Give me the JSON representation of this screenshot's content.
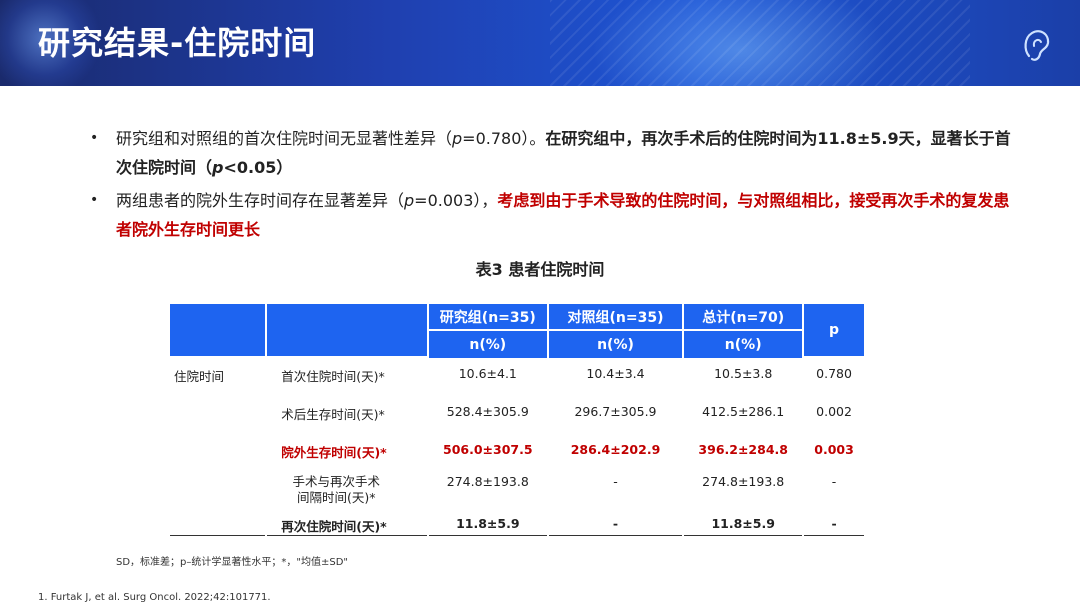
{
  "header": {
    "title": "研究结果-住院时间"
  },
  "bullets": [
    {
      "plain": "研究组和对照组的首次住院时间无显著性差异（",
      "p_label": "p",
      "p_value": "=0.780）。",
      "bold": "在研究组中，再次手术后的住院时间为11.8±5.9天，显著长于首次住院时间（",
      "bold_p": "p",
      "bold_end": "<0.05）"
    },
    {
      "plain": "两组患者的院外生存时间存在显著差异（",
      "p_label": "p",
      "p_value": "=0.003），",
      "red": "考虑到由于手术导致的住院时间，与对照组相比，接受再次手术的复发患者院外生存时间更长"
    }
  ],
  "table": {
    "caption": "表3 患者住院时间",
    "headers": [
      "研究组(n=35)",
      "对照组(n=35)",
      "总计(n=70)",
      "p"
    ],
    "subheader": "n(%)",
    "group_label": "住院时间",
    "rows": [
      {
        "label": "首次住院时间(天)*",
        "study": "10.6±4.1",
        "control": "10.4±3.4",
        "total": "10.5±3.8",
        "p": "0.780"
      },
      {
        "label": "术后生存时间(天)*",
        "study": "528.4±305.9",
        "control": "296.7±305.9",
        "total": "412.5±286.1",
        "p": "0.002"
      },
      {
        "label": "院外生存时间(天)*",
        "study": "506.0±307.5",
        "control": "286.4±202.9",
        "total": "396.2±284.8",
        "p": "0.003"
      },
      {
        "label": "手术与再次手术间隔时间(天)*",
        "label_line1": "手术与再次手术",
        "label_line2": "间隔时间(天)*",
        "study": "274.8±193.8",
        "control": "-",
        "total": "274.8±193.8",
        "p": "-"
      },
      {
        "label": "再次住院时间(天)*",
        "study": "11.8±5.9",
        "control": "-",
        "total": "11.8±5.9",
        "p": "-"
      }
    ],
    "footnote": "SD，标准差；p–统计学显著性水平；*，\"均值±SD\""
  },
  "reference": "1.    Furtak J, et al. Surg Oncol. 2022;42:101771."
}
